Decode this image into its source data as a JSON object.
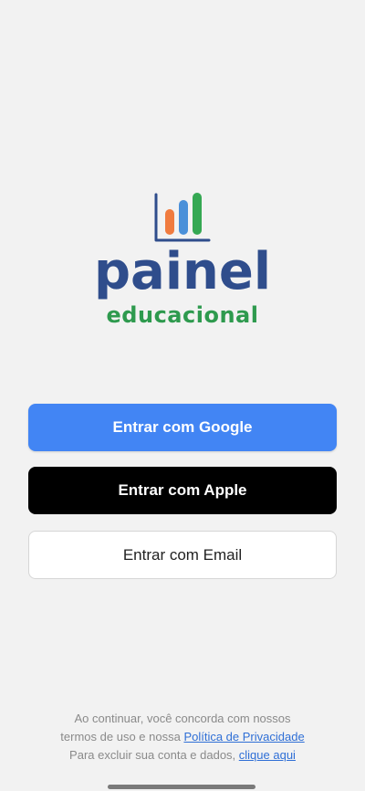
{
  "logo": {
    "icon": "bar-chart-logo-icon",
    "main": "painel",
    "sub": "educacional",
    "colors": {
      "main": "#2f4d8c",
      "sub": "#2e9a4e",
      "bar_orange": "#f07b3f",
      "bar_blue": "#4a90d9",
      "bar_green": "#35a853"
    }
  },
  "buttons": {
    "google": {
      "label": "Entrar com Google",
      "color": "#4285f4"
    },
    "apple": {
      "label": "Entrar com Apple",
      "color": "#000000"
    },
    "email": {
      "label": "Entrar com Email",
      "color": "#ffffff"
    }
  },
  "legal": {
    "line1": "Ao continuar, você concorda com nossos",
    "line2_prefix": "termos de uso e nossa ",
    "privacy_link": "Política de Privacidade",
    "line3_prefix": "Para excluir sua conta e dados, ",
    "delete_link": "clique aqui"
  },
  "home_indicator_color": "#7a7a7a"
}
